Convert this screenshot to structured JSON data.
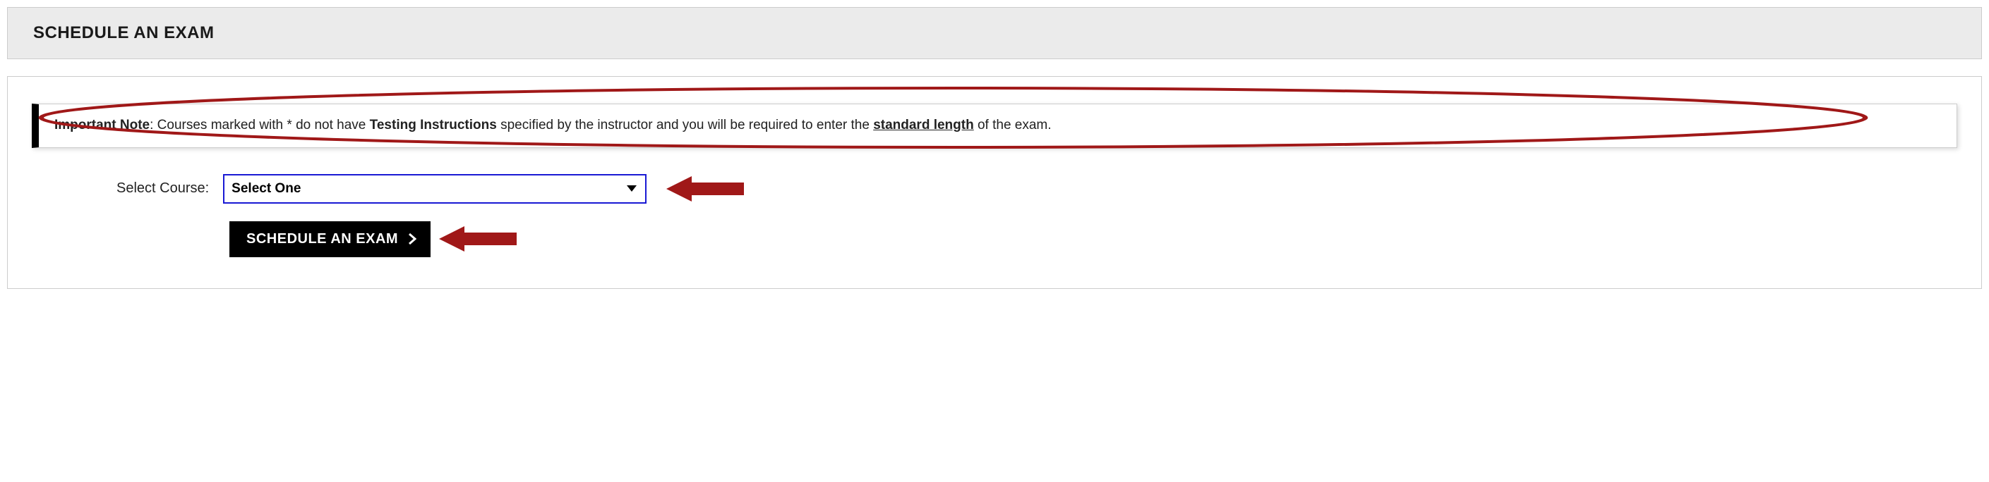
{
  "header": {
    "title": "SCHEDULE AN EXAM"
  },
  "note": {
    "label": "Important Note",
    "text_before": ": Courses marked with * do not have ",
    "testing_instructions": "Testing Instructions",
    "text_middle": " specified by the instructor and you will be required to enter the ",
    "standard_length": "standard length",
    "text_after": " of the exam."
  },
  "form": {
    "select_label": "Select Course:",
    "select_value": "Select One",
    "options": [
      "Select One"
    ]
  },
  "button": {
    "label": "SCHEDULE AN EXAM"
  },
  "annotations": {
    "ellipse_color": "#a01818",
    "arrow_color": "#a01818"
  }
}
